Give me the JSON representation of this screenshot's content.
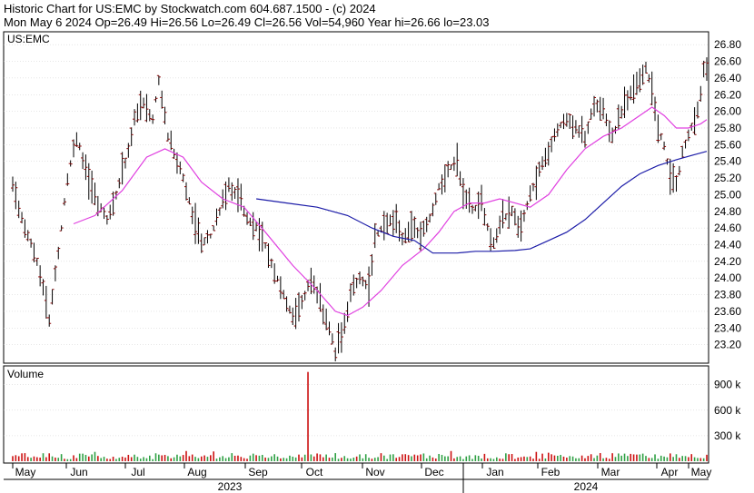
{
  "header": {
    "line1": "Historic Chart for US:EMC by Stockwatch.com 604.687.1500 - (c) 2024",
    "line2": "Mon May  6 2024   Op=26.49   Hi=26.56   Lo=26.49   Cl=26.56   Vol=54,960   Year hi=26.66   lo=23.03"
  },
  "colors": {
    "price_bar": "#8b0000",
    "ma_short": "#e040e0",
    "ma_long": "#1c1ca8",
    "volume_up": "#2ea043",
    "volume_down": "#cc1111",
    "grid": "#cccccc"
  },
  "chart_data": {
    "type": "ohlc",
    "symbol_label": "US:EMC",
    "volume_label": "Volume",
    "price_axis": {
      "min": 23.0,
      "max": 26.9,
      "ticks": [
        "23.20",
        "23.40",
        "23.60",
        "23.80",
        "24.00",
        "24.20",
        "24.40",
        "24.60",
        "24.80",
        "25.00",
        "25.20",
        "25.40",
        "25.60",
        "25.80",
        "26.00",
        "26.20",
        "26.40",
        "26.60",
        "26.80"
      ]
    },
    "volume_axis": {
      "max": 1100000,
      "ticks": [
        {
          "value": 300000,
          "label": "300 k"
        },
        {
          "value": 600000,
          "label": "600 k"
        },
        {
          "value": 900000,
          "label": "900 k"
        }
      ]
    },
    "x_axis": {
      "months": [
        "May",
        "Jun",
        "Jul",
        "Aug",
        "Sep",
        "Oct",
        "Nov",
        "Dec",
        "Jan",
        "Feb",
        "Mar",
        "Apr",
        "May"
      ],
      "years": [
        "2023",
        "2024"
      ]
    },
    "price_anchors": [
      [
        0,
        25.1
      ],
      [
        4,
        24.6
      ],
      [
        8,
        24.2
      ],
      [
        10,
        23.9
      ],
      [
        12,
        23.5
      ],
      [
        15,
        24.3
      ],
      [
        18,
        25.2
      ],
      [
        21,
        25.7
      ],
      [
        25,
        25.2
      ],
      [
        28,
        24.9
      ],
      [
        31,
        24.7
      ],
      [
        34,
        25.0
      ],
      [
        37,
        25.4
      ],
      [
        40,
        25.9
      ],
      [
        43,
        26.1
      ],
      [
        46,
        25.9
      ],
      [
        48,
        26.4
      ],
      [
        51,
        25.7
      ],
      [
        53,
        25.5
      ],
      [
        56,
        25.2
      ],
      [
        59,
        24.8
      ],
      [
        62,
        24.4
      ],
      [
        65,
        24.5
      ],
      [
        68,
        24.8
      ],
      [
        71,
        25.1
      ],
      [
        74,
        25.0
      ],
      [
        77,
        24.7
      ],
      [
        80,
        24.6
      ],
      [
        83,
        24.4
      ],
      [
        86,
        24.1
      ],
      [
        89,
        23.8
      ],
      [
        92,
        23.5
      ],
      [
        95,
        23.7
      ],
      [
        98,
        24.0
      ],
      [
        101,
        23.7
      ],
      [
        104,
        23.4
      ],
      [
        106,
        23.1
      ],
      [
        108,
        23.3
      ],
      [
        111,
        23.8
      ],
      [
        114,
        24.0
      ],
      [
        117,
        23.9
      ],
      [
        119,
        24.5
      ],
      [
        122,
        24.6
      ],
      [
        125,
        24.7
      ],
      [
        128,
        24.5
      ],
      [
        131,
        24.6
      ],
      [
        134,
        24.5
      ],
      [
        137,
        24.7
      ],
      [
        140,
        25.1
      ],
      [
        143,
        25.3
      ],
      [
        146,
        25.4
      ],
      [
        148,
        25.0
      ],
      [
        151,
        24.8
      ],
      [
        154,
        24.9
      ],
      [
        156,
        24.6
      ],
      [
        158,
        24.4
      ],
      [
        161,
        24.7
      ],
      [
        164,
        24.8
      ],
      [
        167,
        24.6
      ],
      [
        170,
        25.0
      ],
      [
        173,
        25.3
      ],
      [
        176,
        25.5
      ],
      [
        179,
        25.8
      ],
      [
        182,
        25.9
      ],
      [
        185,
        25.8
      ],
      [
        188,
        25.7
      ],
      [
        191,
        26.1
      ],
      [
        194,
        26.0
      ],
      [
        197,
        25.7
      ],
      [
        200,
        26.0
      ],
      [
        203,
        26.2
      ],
      [
        206,
        26.4
      ],
      [
        208,
        26.5
      ],
      [
        210,
        26.3
      ],
      [
        212,
        25.8
      ],
      [
        214,
        25.6
      ],
      [
        216,
        25.2
      ],
      [
        218,
        25.1
      ],
      [
        220,
        25.5
      ],
      [
        222,
        25.7
      ],
      [
        224,
        25.9
      ],
      [
        226,
        26.2
      ],
      [
        227,
        26.5
      ],
      [
        228,
        26.56
      ]
    ],
    "volume_base": 60000,
    "volume_spikes": [
      [
        97,
        1050000
      ],
      [
        57,
        120000
      ],
      [
        27,
        110000
      ],
      [
        66,
        115000
      ],
      [
        144,
        120000
      ],
      [
        172,
        110000
      ],
      [
        176,
        100000
      ]
    ],
    "ma_short": [
      [
        0,
        null
      ],
      [
        20,
        24.65
      ],
      [
        27,
        24.75
      ],
      [
        36,
        25.05
      ],
      [
        44,
        25.45
      ],
      [
        50,
        25.55
      ],
      [
        56,
        25.45
      ],
      [
        62,
        25.15
      ],
      [
        69,
        24.95
      ],
      [
        76,
        24.85
      ],
      [
        83,
        24.55
      ],
      [
        92,
        24.15
      ],
      [
        100,
        23.85
      ],
      [
        106,
        23.6
      ],
      [
        110,
        23.55
      ],
      [
        115,
        23.65
      ],
      [
        121,
        23.85
      ],
      [
        128,
        24.15
      ],
      [
        135,
        24.35
      ],
      [
        140,
        24.55
      ],
      [
        145,
        24.8
      ],
      [
        150,
        24.9
      ],
      [
        155,
        24.9
      ],
      [
        160,
        24.95
      ],
      [
        165,
        24.9
      ],
      [
        170,
        24.85
      ],
      [
        176,
        25.0
      ],
      [
        182,
        25.3
      ],
      [
        188,
        25.55
      ],
      [
        194,
        25.7
      ],
      [
        200,
        25.8
      ],
      [
        206,
        25.95
      ],
      [
        210,
        26.05
      ],
      [
        214,
        25.95
      ],
      [
        218,
        25.8
      ],
      [
        222,
        25.8
      ],
      [
        226,
        25.85
      ],
      [
        228,
        25.9
      ]
    ],
    "ma_long": [
      [
        0,
        null
      ],
      [
        80,
        24.95
      ],
      [
        90,
        24.9
      ],
      [
        100,
        24.85
      ],
      [
        110,
        24.75
      ],
      [
        118,
        24.6
      ],
      [
        125,
        24.5
      ],
      [
        132,
        24.45
      ],
      [
        138,
        24.3
      ],
      [
        146,
        24.3
      ],
      [
        152,
        24.32
      ],
      [
        158,
        24.32
      ],
      [
        165,
        24.33
      ],
      [
        170,
        24.35
      ],
      [
        176,
        24.45
      ],
      [
        182,
        24.55
      ],
      [
        188,
        24.7
      ],
      [
        194,
        24.9
      ],
      [
        200,
        25.1
      ],
      [
        206,
        25.25
      ],
      [
        212,
        25.35
      ],
      [
        218,
        25.42
      ],
      [
        224,
        25.48
      ],
      [
        228,
        25.52
      ]
    ]
  }
}
